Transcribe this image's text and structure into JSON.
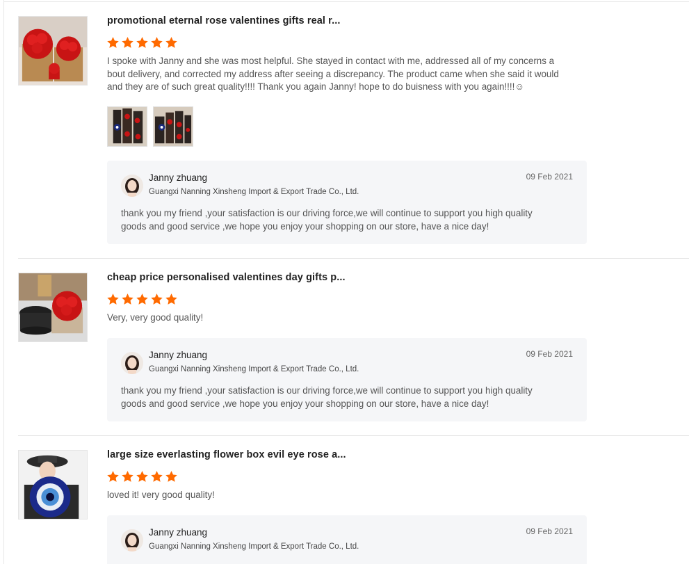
{
  "reviews": [
    {
      "title": "promotional eternal rose valentines gifts real r...",
      "rating": 5,
      "text": "I spoke with Janny and she was most helpful. She stayed in contact with me, addressed all of my concerns about delivery, and corrected my address after seeing a discrepancy. The product came when she said it would and they are of such great quality!!!! Thank you again Janny! hope to do buisness with you again!!!!☺",
      "reply": {
        "name": "Janny zhuang",
        "company": "Guangxi Nanning Xinsheng Import & Export Trade Co., Ltd.",
        "date": "09 Feb 2021",
        "text": "thank you my friend ,your satisfaction is our driving force,we will continue to support you high quality goods and good service ,we hope you enjoy your shopping on our store, have a nice day!"
      }
    },
    {
      "title": "cheap price personalised valentines day gifts p...",
      "rating": 5,
      "text": "Very, very good quality!",
      "reply": {
        "name": "Janny zhuang",
        "company": "Guangxi Nanning Xinsheng Import & Export Trade Co., Ltd.",
        "date": "09 Feb 2021",
        "text": "thank you my friend ,your satisfaction is our driving force,we will continue to support you high quality goods and good service ,we hope you enjoy your shopping on our store, have a nice day!"
      }
    },
    {
      "title": "large size everlasting flower box evil eye rose a...",
      "rating": 5,
      "text": "loved it! very good quality!",
      "reply": {
        "name": "Janny zhuang",
        "company": "Guangxi Nanning Xinsheng Import & Export Trade Co., Ltd.",
        "date": "09 Feb 2021"
      }
    }
  ],
  "colors": {
    "star": "#ff6a00",
    "reply_bg": "#f5f6f8",
    "divider": "#e3e3e3"
  },
  "icons": {
    "rating": "star-icon"
  }
}
